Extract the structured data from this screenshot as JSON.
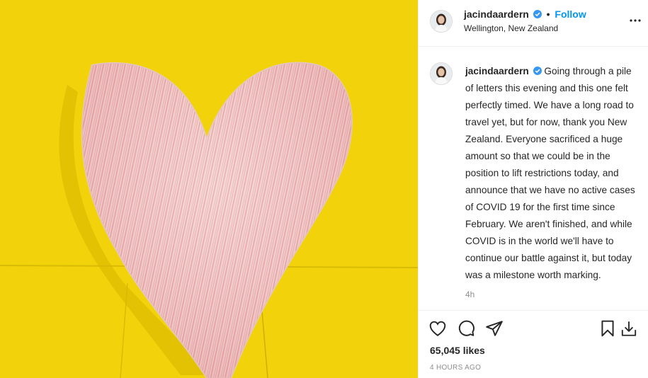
{
  "post": {
    "username": "jacindaardern",
    "follow_label": "Follow",
    "dot": "•",
    "location": "Wellington, New Zealand",
    "caption": "Going through a pile of letters this evening and this one felt perfectly timed. We have a long road to travel yet, but for now, thank you New Zealand. Everyone sacrificed a huge amount so that we could be in the position to lift restrictions today, and announce that we have no active cases of COVID 19 for the first time since February. We aren't finished, and while COVID is in the world we'll have to continue our battle against it, but today was a milestone worth marking.",
    "relative_time": "4h",
    "likes": "65,045 likes",
    "posted_time": "4 HOURS AGO"
  },
  "colors": {
    "accent": "#0095f6",
    "photo_background": "#f2d20a",
    "heart_paper": "#f3d6d2",
    "heart_crayon": "#e07a80"
  },
  "icons": {
    "verified": "verified-badge-icon",
    "more": "more-options-icon",
    "like": "heart-outline-icon",
    "comment": "comment-bubble-icon",
    "share": "paper-plane-icon",
    "save": "bookmark-icon",
    "download": "download-icon"
  }
}
